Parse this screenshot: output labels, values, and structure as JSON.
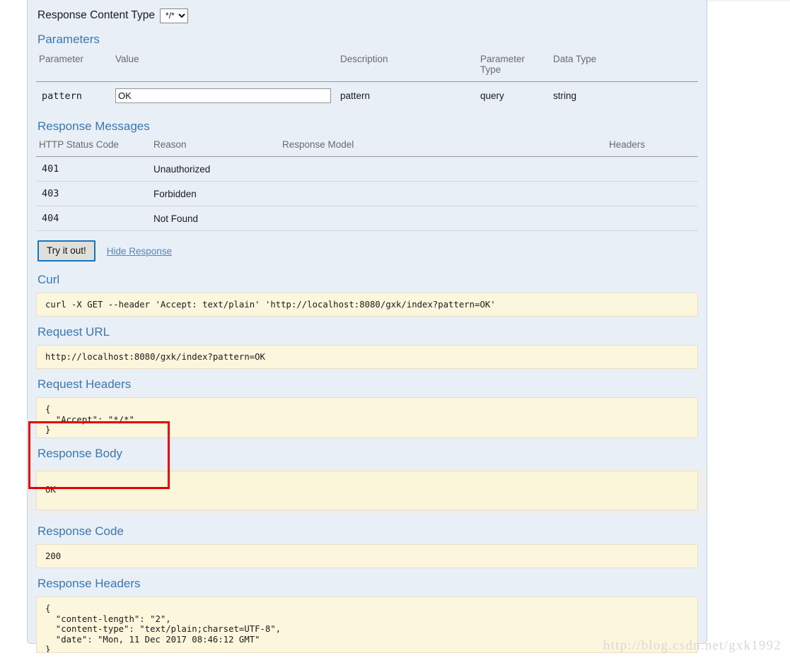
{
  "response_content_type": {
    "label": "Response Content Type",
    "selected": "*/*",
    "options": [
      "*/*"
    ]
  },
  "parameters": {
    "title": "Parameters",
    "columns": [
      "Parameter",
      "Value",
      "Description",
      "Parameter Type",
      "Data Type"
    ],
    "rows": [
      {
        "name": "pattern",
        "value": "OK",
        "description": "pattern",
        "parameter_type": "query",
        "data_type": "string"
      }
    ]
  },
  "response_messages": {
    "title": "Response Messages",
    "columns": [
      "HTTP Status Code",
      "Reason",
      "Response Model",
      "Headers"
    ],
    "rows": [
      {
        "code": "401",
        "reason": "Unauthorized",
        "model": "",
        "headers": ""
      },
      {
        "code": "403",
        "reason": "Forbidden",
        "model": "",
        "headers": ""
      },
      {
        "code": "404",
        "reason": "Not Found",
        "model": "",
        "headers": ""
      }
    ]
  },
  "actions": {
    "try_it_out": "Try it out!",
    "hide_response": "Hide Response"
  },
  "curl": {
    "title": "Curl",
    "command": "curl -X GET --header 'Accept: text/plain' 'http://localhost:8080/gxk/index?pattern=OK'"
  },
  "request_url": {
    "title": "Request URL",
    "url": "http://localhost:8080/gxk/index?pattern=OK"
  },
  "request_headers": {
    "title": "Request Headers",
    "body": "{\n  \"Accept\": \"*/*\"\n}"
  },
  "response_body": {
    "title": "Response Body",
    "body": "OK"
  },
  "response_code": {
    "title": "Response Code",
    "code": "200"
  },
  "response_headers": {
    "title": "Response Headers",
    "body": "{\n  \"content-length\": \"2\",\n  \"content-type\": \"text/plain;charset=UTF-8\",\n  \"date\": \"Mon, 11 Dec 2017 08:46:12 GMT\"\n}"
  },
  "watermark": "http://blog.csdn.net/gxk1992",
  "colors": {
    "heading": "#3b77af",
    "panel_background": "#e8eff7",
    "code_background": "#fcf6dd",
    "button_border": "#1675c0",
    "annotation": "#e60000"
  }
}
